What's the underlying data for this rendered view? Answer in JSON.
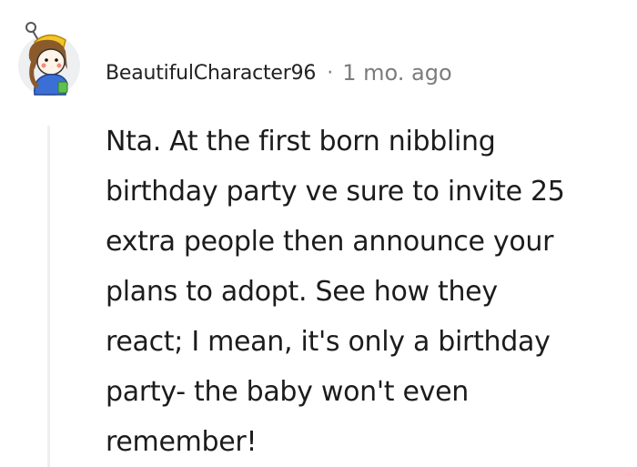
{
  "comment": {
    "author": "BeautifulCharacter96",
    "separator": "·",
    "timestamp": "1 mo. ago",
    "avatar_icon": "snoo-avatar-icon",
    "body": "Nta. At the first born nibbling\nbirthday party ve sure to invite 25\nextra people then announce your\nplans to adopt. See how they\nreact; I mean, it's only a birthday\nparty- the baby won't even\nremember!"
  }
}
